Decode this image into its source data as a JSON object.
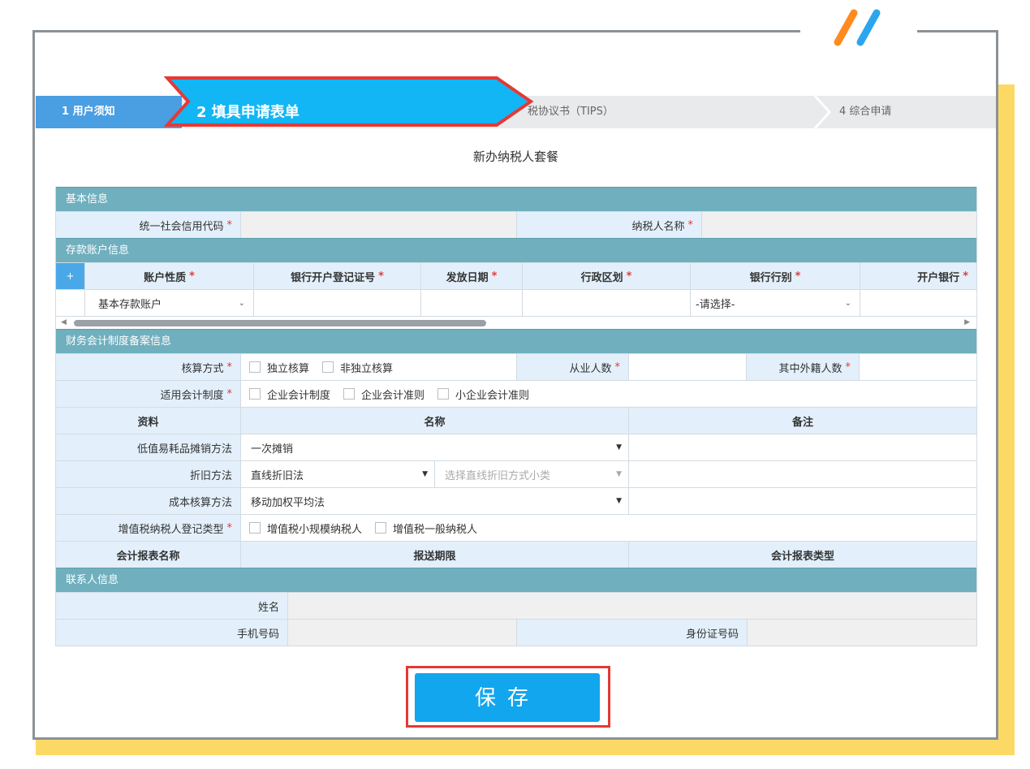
{
  "steps": {
    "step1": "1 用户须知",
    "step2": "2 填具申请表单",
    "step3": "税协议书（TIPS）",
    "step4": "4 综合申请"
  },
  "page_title": "新办纳税人套餐",
  "required_mark": "*",
  "basic": {
    "section": "基本信息",
    "credit_code_label": "统一社会信用代码",
    "taxpayer_name_label": "纳税人名称"
  },
  "deposit": {
    "section": "存款账户信息",
    "add": "+",
    "headers": [
      "账户性质",
      "银行开户登记证号",
      "发放日期",
      "行政区划",
      "银行行别",
      "开户银行"
    ],
    "account_type_value": "基本存款账户",
    "bank_type_placeholder": "-请选择-"
  },
  "finance": {
    "section": "财务会计制度备案信息",
    "accounting_method_label": "核算方式",
    "accounting_options": [
      "独立核算",
      "非独立核算"
    ],
    "employees_label": "从业人数",
    "foreign_label": "其中外籍人数",
    "system_label": "适用会计制度",
    "system_options": [
      "企业会计制度",
      "企业会计准则",
      "小企业会计准则"
    ],
    "col_material": "资料",
    "col_name": "名称",
    "col_note": "备注",
    "low_value_label": "低值易耗品摊销方法",
    "low_value_value": "一次摊销",
    "depreciation_label": "折旧方法",
    "depreciation_value": "直线折旧法",
    "depreciation_sub_placeholder": "选择直线折旧方式小类",
    "cost_label": "成本核算方法",
    "cost_value": "移动加权平均法",
    "vat_label": "增值税纳税人登记类型",
    "vat_options": [
      "增值税小规模纳税人",
      "增值税一般纳税人"
    ],
    "report_name": "会计报表名称",
    "report_period": "报送期限",
    "report_type": "会计报表类型"
  },
  "contact": {
    "section": "联系人信息",
    "name_label": "姓名",
    "phone_label": "手机号码",
    "id_label": "身份证号码"
  },
  "save_label": "保存",
  "colors": {
    "section_bg": "#6fafbe",
    "label_bg": "#e3f0fb",
    "step_active": "#12b6f5",
    "highlight": "#e53935",
    "save": "#12a6ee"
  }
}
